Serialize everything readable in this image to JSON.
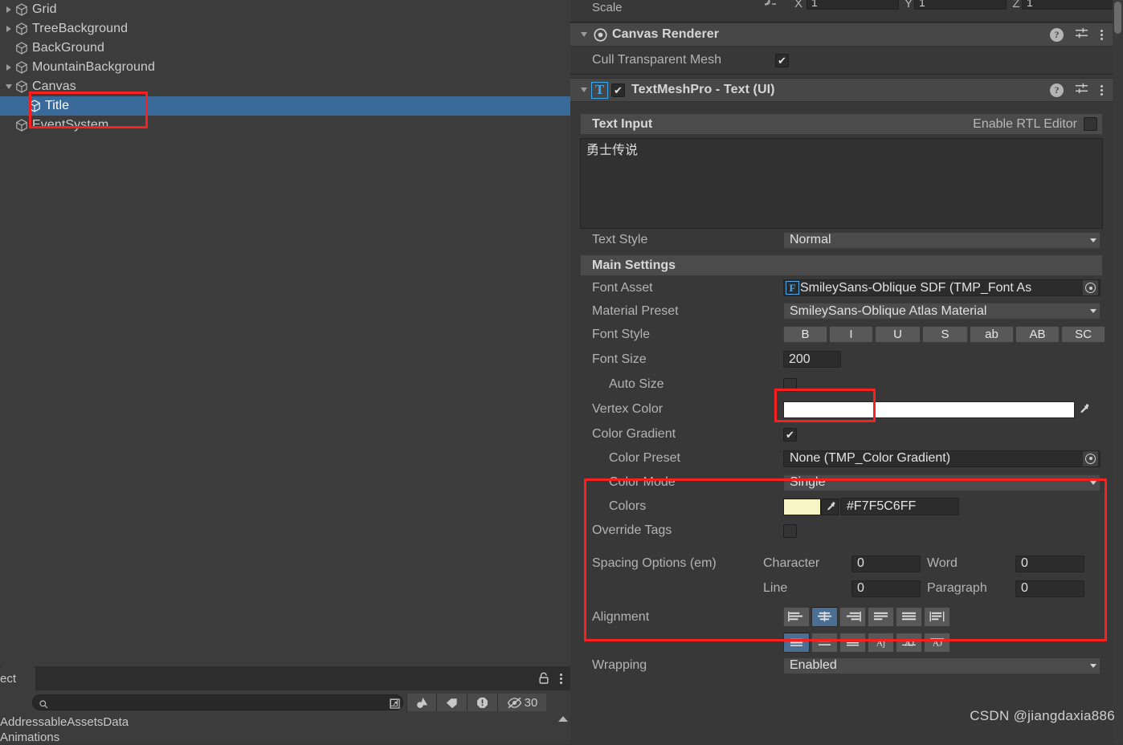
{
  "hierarchy": {
    "items": [
      {
        "label": "Grid",
        "expandable": true,
        "expanded": false,
        "indent": 0,
        "selected": false
      },
      {
        "label": "TreeBackground",
        "expandable": true,
        "expanded": false,
        "indent": 0,
        "selected": false
      },
      {
        "label": "BackGround",
        "expandable": false,
        "expanded": false,
        "indent": 0,
        "selected": false
      },
      {
        "label": "MountainBackground",
        "expandable": true,
        "expanded": false,
        "indent": 0,
        "selected": false
      },
      {
        "label": "Canvas",
        "expandable": true,
        "expanded": true,
        "indent": 0,
        "selected": false
      },
      {
        "label": "Title",
        "expandable": false,
        "expanded": false,
        "indent": 1,
        "selected": true
      },
      {
        "label": "EventSystem",
        "expandable": false,
        "expanded": false,
        "indent": 0,
        "selected": false
      }
    ]
  },
  "project": {
    "tab_label": "ect",
    "lock_icon": "lock-icon",
    "menu_icon": "kebab-menu-icon",
    "search_placeholder": "",
    "search_value": "",
    "search_icon": "search-icon",
    "save_search_icon": "save-search-icon",
    "filter_type_icon": "filter-by-type-icon",
    "filter_label_icon": "filter-by-label-icon",
    "filter_warning_icon": "filter-warning-icon",
    "hidden_icon": "hidden-count-icon",
    "hidden_count": "30",
    "items": [
      "AddressableAssetsData",
      "Animations"
    ],
    "scroll_up_icon": "scroll-up-arrow-icon"
  },
  "inspector": {
    "scale": {
      "label": "Scale",
      "link_icon": "constrain-proportions-icon",
      "axes": [
        {
          "label": "X",
          "value": "1"
        },
        {
          "label": "Y",
          "value": "1"
        },
        {
          "label": "Z",
          "value": "1"
        }
      ]
    },
    "canvas_renderer": {
      "title": "Canvas Renderer",
      "icon": "canvas-renderer-icon",
      "expanded": true,
      "help_icon": "help-icon",
      "preset_icon": "preset-icon",
      "menu_icon": "kebab-menu-icon",
      "cull_label": "Cull Transparent Mesh",
      "cull_checked": true
    },
    "tmp_text": {
      "title": "TextMeshPro - Text (UI)",
      "icon_letter": "T",
      "enabled": true,
      "expanded": true,
      "help_icon": "help-icon",
      "preset_icon": "preset-icon",
      "menu_icon": "kebab-menu-icon",
      "text_input_header": "Text Input",
      "rtl_label": "Enable RTL Editor",
      "rtl_checked": false,
      "text_value": "勇士传说",
      "text_style_label": "Text Style",
      "text_style_value": "Normal",
      "main_settings_header": "Main Settings",
      "font_asset_label": "Font Asset",
      "font_asset_value": "SmileySans-Oblique SDF (TMP_Font As",
      "material_preset_label": "Material Preset",
      "material_preset_value": "SmileySans-Oblique Atlas Material",
      "font_style_label": "Font Style",
      "font_style_buttons": [
        "B",
        "I",
        "U",
        "S",
        "ab",
        "AB",
        "SC"
      ],
      "font_size_label": "Font Size",
      "font_size_value": "200",
      "auto_size_label": "Auto Size",
      "auto_size_checked": false,
      "vertex_color_label": "Vertex Color",
      "vertex_color_value": "#FFFFFF",
      "eyedropper_icon": "eyedropper-icon",
      "color_gradient_label": "Color Gradient",
      "color_gradient_checked": true,
      "color_preset_label": "Color Preset",
      "color_preset_value": "None (TMP_Color Gradient)",
      "color_mode_label": "Color Mode",
      "color_mode_value": "Single",
      "colors_label": "Colors",
      "colors_swatch": "#F7F5C6",
      "colors_hex": "#F7F5C6FF",
      "override_tags_label": "Override Tags",
      "override_tags_checked": false,
      "spacing_label": "Spacing Options (em)",
      "spacing_character_label": "Character",
      "spacing_character_value": "0",
      "spacing_word_label": "Word",
      "spacing_word_value": "0",
      "spacing_line_label": "Line",
      "spacing_line_value": "0",
      "spacing_paragraph_label": "Paragraph",
      "spacing_paragraph_value": "0",
      "alignment_label": "Alignment",
      "alignment_h_icons": [
        "align-left-icon",
        "align-center-icon",
        "align-right-icon",
        "align-justified-icon",
        "align-flush-icon",
        "align-geometry-icon"
      ],
      "alignment_h_selected": 1,
      "alignment_v_icons": [
        "align-top-icon",
        "align-middle-icon",
        "align-baseline-icon",
        "align-bottom-icon",
        "align-capline-icon",
        "align-midline-icon"
      ],
      "alignment_v_selected": 0,
      "wrapping_label": "Wrapping",
      "wrapping_value": "Enabled"
    }
  },
  "watermark": "CSDN @jiangdaxia886"
}
